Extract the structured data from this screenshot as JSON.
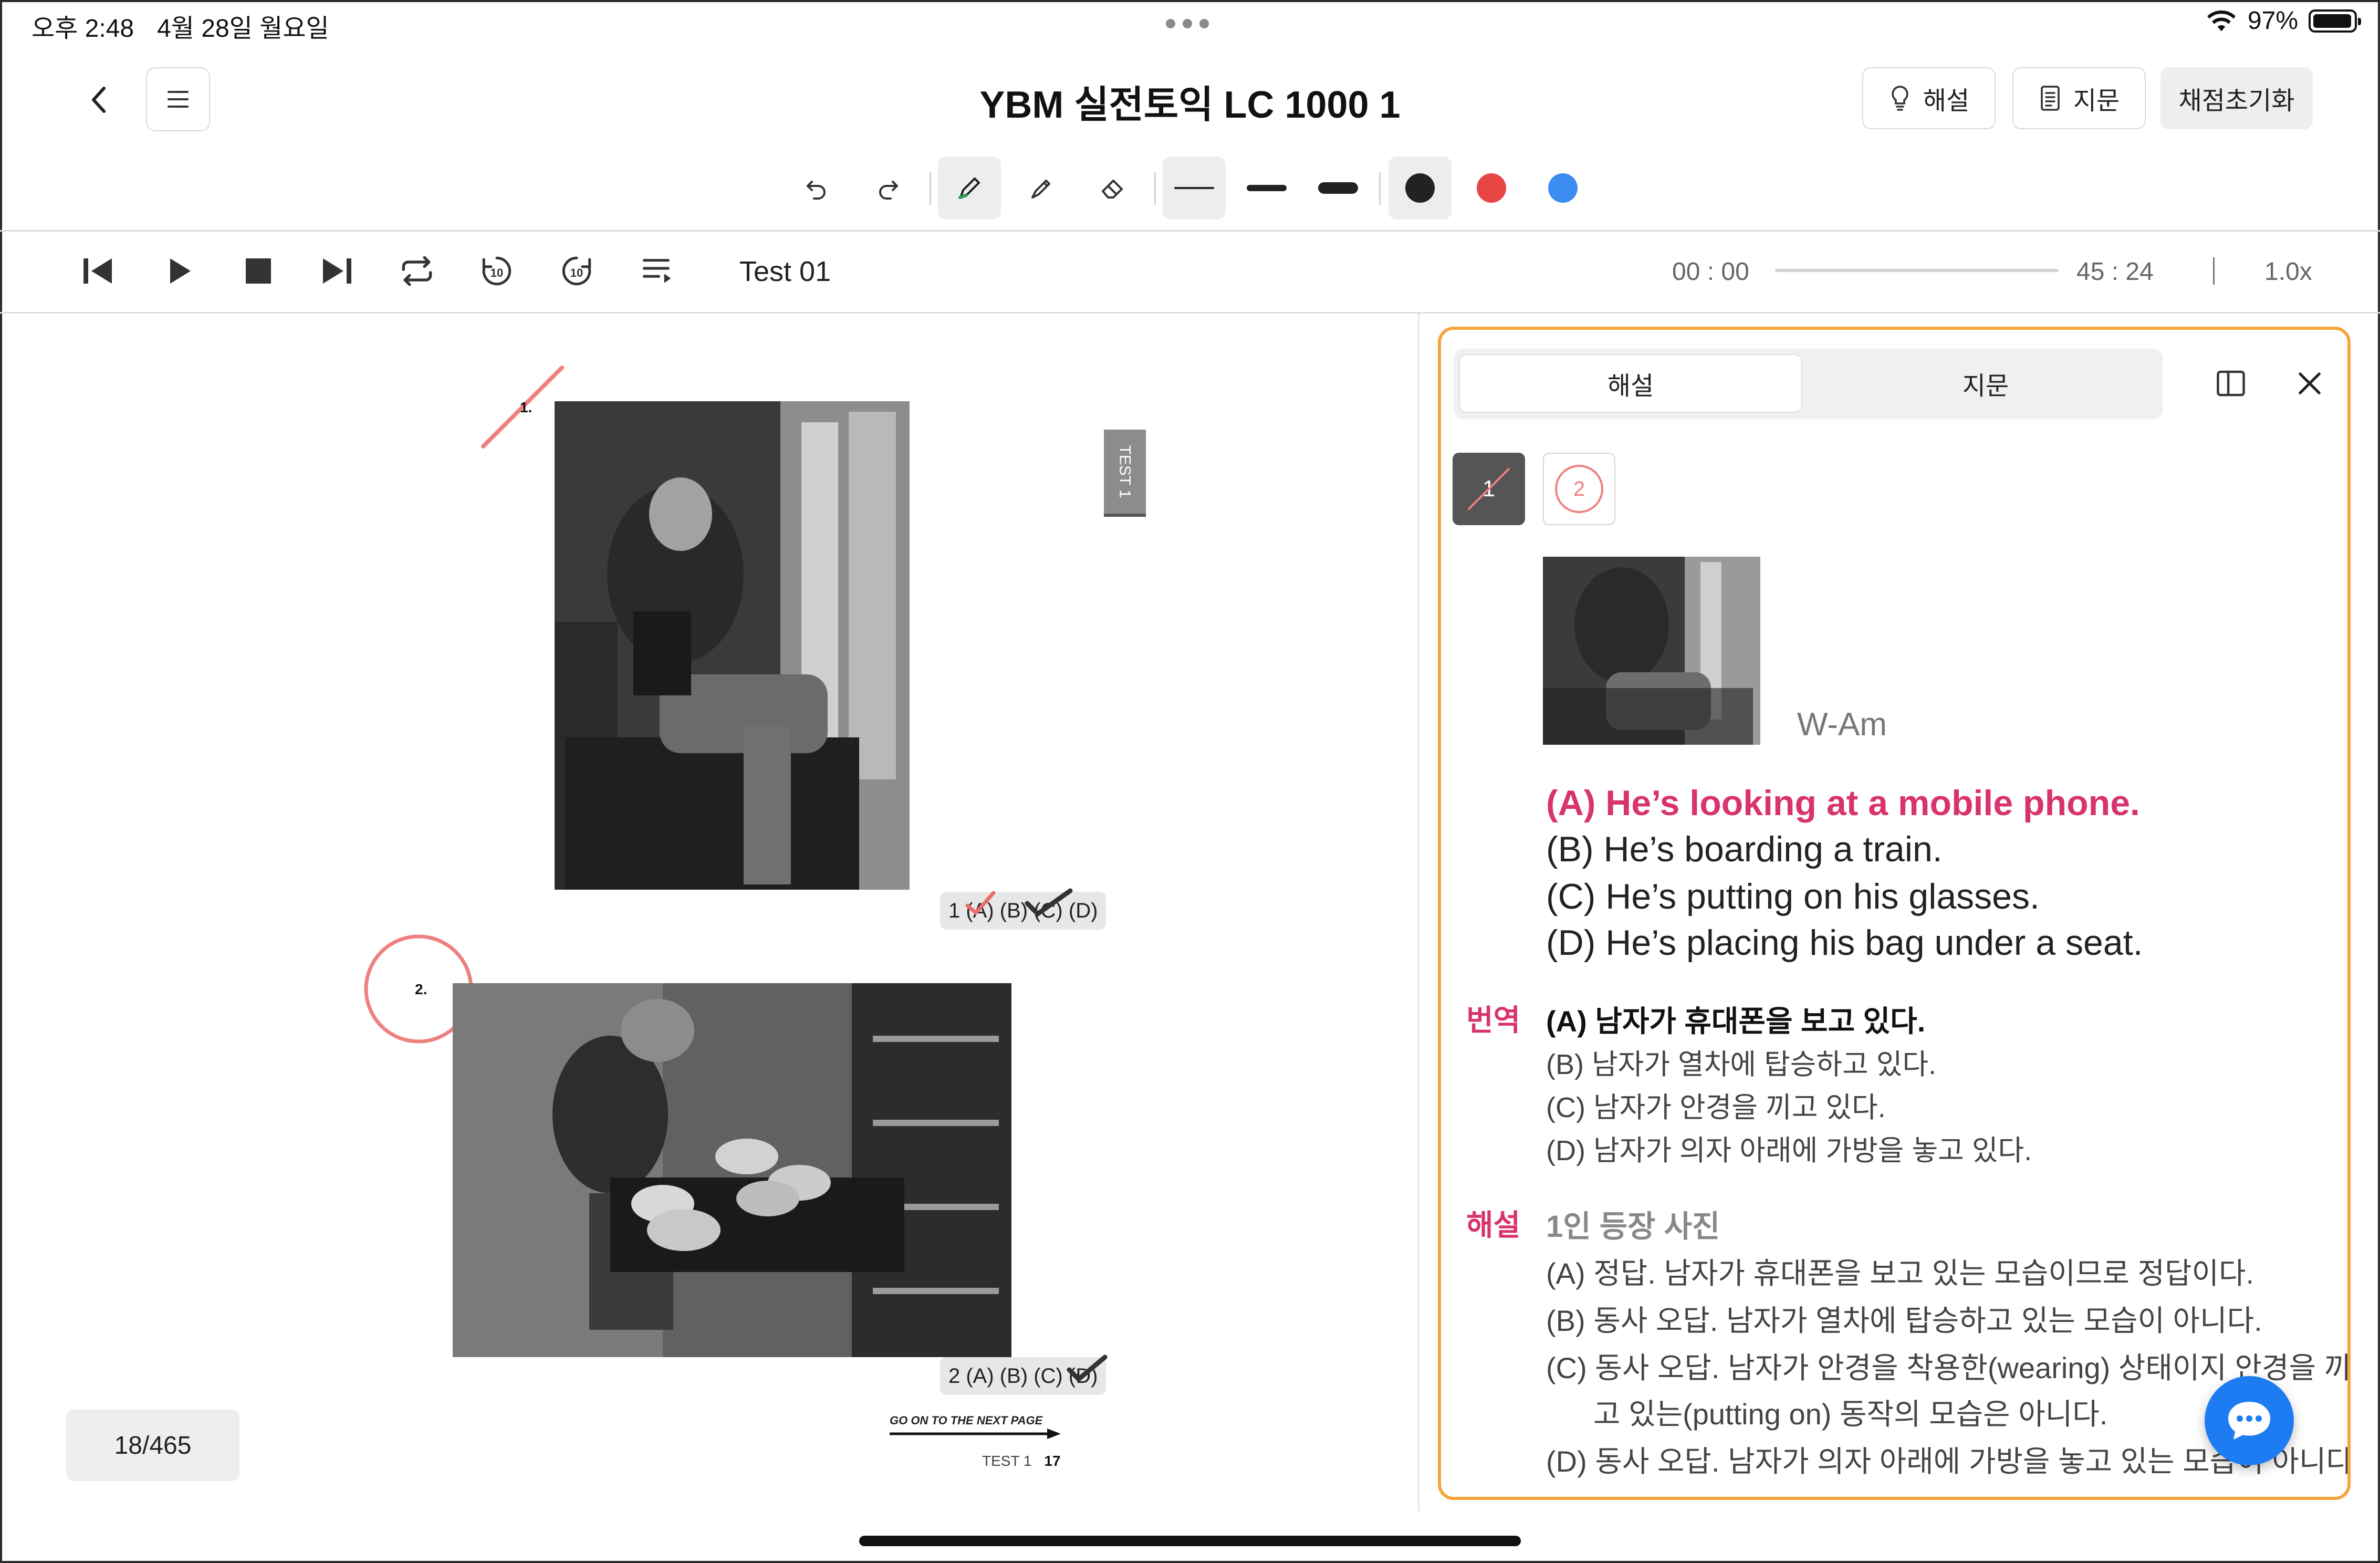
{
  "status": {
    "time": "오후 2:48",
    "date": "4월 28일 월요일",
    "battery": "97%"
  },
  "header": {
    "title": "YBM 실전토익 LC 1000 1",
    "explain_label": "해설",
    "passage_label": "지문",
    "reset_label": "채점초기화"
  },
  "toolbar": {
    "icons": [
      "undo-icon",
      "redo-icon",
      "pen-icon",
      "highlighter-icon",
      "eraser-icon",
      "line-thin",
      "line-medium",
      "line-thick"
    ],
    "colors": [
      "#222222",
      "#e84545",
      "#3b8cf0"
    ],
    "selected_tool": "pen",
    "selected_color": "#222222"
  },
  "player": {
    "track": "Test 01",
    "current_time": "00 : 00",
    "total_time": "45 : 24",
    "speed": "1.0x",
    "progress": 0
  },
  "page": {
    "q1_number": "1.",
    "q2_number": "2.",
    "test_tab": "TEST 1",
    "q1_choices": "1 (A) (B) (C) (D)",
    "q2_choices": "2 (A) (B) (C) (D)",
    "next_page": "GO ON TO THE NEXT PAGE",
    "footer_test": "TEST 1",
    "footer_page": "17",
    "page_counter": "18/465"
  },
  "panel": {
    "tab_explain": "해설",
    "tab_passage": "지문",
    "q_tab1": "1",
    "q_tab2": "2",
    "speaker": "W-Am",
    "options": [
      "(A) He’s looking at a mobile phone.",
      "(B) He’s boarding a train.",
      "(C) He’s putting on his glasses.",
      "(D) He’s placing his bag under a seat."
    ],
    "translation_label": "번역",
    "translations": [
      "(A) 남자가 휴대폰을 보고 있다.",
      "(B) 남자가 열차에 탑승하고 있다.",
      "(C) 남자가 안경을 끼고 있다.",
      "(D) 남자가 의자 아래에 가방을 놓고 있다."
    ],
    "explanation_label": "해설",
    "explanation_title": "1인 등장 사진",
    "explanations": [
      "(A) 정답. 남자가 휴대폰을 보고 있는 모습이므로 정답이다.",
      "(B) 동사 오답. 남자가 열차에 탑승하고 있는 모습이 아니다.",
      "(C) 동사 오답. 남자가 안경을 착용한(wearing) 상태이지 안경을 끼",
      "고 있는(putting on) 동작의 모습은 아니다.",
      "(D) 동사 오답. 남자가 의자 아래에 가방을 놓고 있는 모습이 아니다."
    ]
  }
}
